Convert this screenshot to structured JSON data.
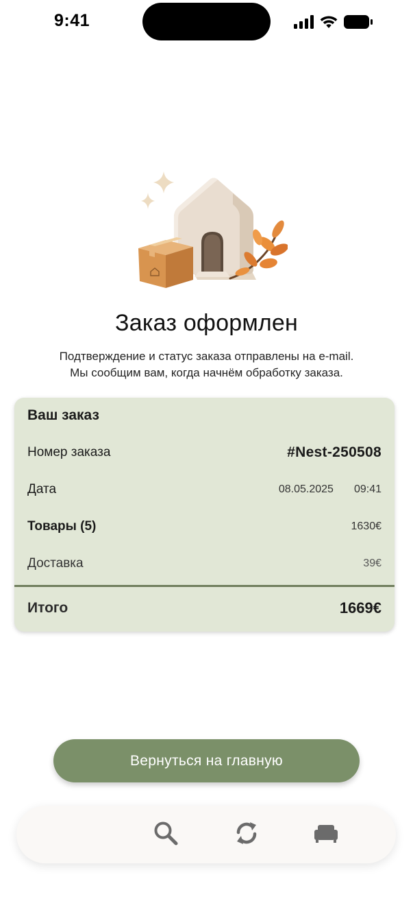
{
  "status_bar": {
    "time": "9:41"
  },
  "hero": {
    "illustration": "house-with-parcel-and-leaves",
    "title": "Заказ оформлен",
    "subtitle_line1": "Подтверждение и статус заказа отправлены на e-mail.",
    "subtitle_line2": "Мы сообщим вам, когда начнём обработку заказа."
  },
  "order": {
    "heading": "Ваш заказ",
    "number_label": "Номер заказа",
    "number_value": "#Nest-250508",
    "date_label": "Дата",
    "date_value": "08.05.2025",
    "time_value": "09:41",
    "items_label": "Товары (5)",
    "items_value": "1630€",
    "delivery_label": "Доставка",
    "delivery_value": "39€",
    "total_label": "Итого",
    "total_value": "1669€"
  },
  "actions": {
    "home_button": "Вернуться на главную"
  },
  "bottom_nav": {
    "items": [
      {
        "icon": "search-icon"
      },
      {
        "icon": "refresh-icon"
      },
      {
        "icon": "sofa-icon"
      }
    ]
  },
  "colors": {
    "card_bg": "#e1e7d6",
    "divider": "#6f7d5c",
    "button_bg": "#7b9069",
    "nav_bg": "#faf8f6",
    "nav_icon": "#6b6b6b"
  }
}
